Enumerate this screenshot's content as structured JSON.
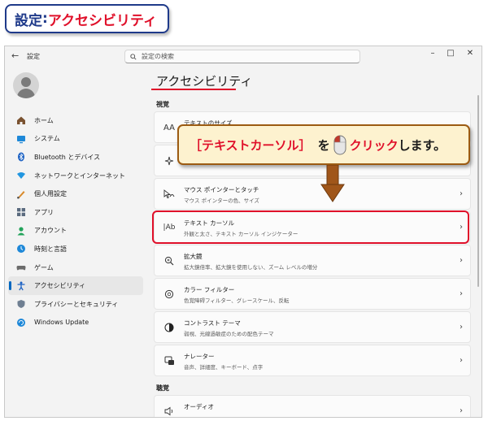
{
  "heading": {
    "key": "設定",
    "sep": ":",
    "value": "アクセシビリティ"
  },
  "window": {
    "back_icon": "back-arrow-icon",
    "title": "設定",
    "search_placeholder": "設定の検索",
    "controls": [
      "minimize-icon",
      "maximize-icon",
      "close-icon"
    ]
  },
  "nav": {
    "items": [
      {
        "label": "ホーム",
        "icon": "home-icon"
      },
      {
        "label": "システム",
        "icon": "system-icon"
      },
      {
        "label": "Bluetooth とデバイス",
        "icon": "bluetooth-icon"
      },
      {
        "label": "ネットワークとインターネット",
        "icon": "network-icon"
      },
      {
        "label": "個人用設定",
        "icon": "personalization-icon"
      },
      {
        "label": "アプリ",
        "icon": "apps-icon"
      },
      {
        "label": "アカウント",
        "icon": "account-icon"
      },
      {
        "label": "時刻と言語",
        "icon": "time-language-icon"
      },
      {
        "label": "ゲーム",
        "icon": "gaming-icon"
      },
      {
        "label": "アクセシビリティ",
        "icon": "accessibility-icon",
        "active": true
      },
      {
        "label": "プライバシーとセキュリティ",
        "icon": "privacy-icon"
      },
      {
        "label": "Windows Update",
        "icon": "windows-update-icon"
      }
    ]
  },
  "main": {
    "title": "アクセシビリティ",
    "section_vision": "視覚",
    "section_hearing": "聴覚",
    "cards": [
      {
        "title": "テキストのサイズ",
        "desc": "",
        "icon": "text-size-icon"
      },
      {
        "title": "",
        "desc": "",
        "icon": "visual-effects-icon"
      },
      {
        "title": "マウス ポインターとタッチ",
        "desc": "マウス ポインターの色、サイズ",
        "icon": "mouse-pointer-icon"
      },
      {
        "title": "テキスト カーソル",
        "desc": "外観と太さ、テキスト カーソル インジケーター",
        "icon": "text-cursor-icon"
      },
      {
        "title": "拡大鏡",
        "desc": "拡大鏡倍率、拡大鏡を使用しない、ズーム レベルの増分",
        "icon": "magnifier-icon"
      },
      {
        "title": "カラー フィルター",
        "desc": "色覚障碍フィルター、グレースケール、反転",
        "icon": "color-filter-icon"
      },
      {
        "title": "コントラスト テーマ",
        "desc": "弱視、光線過敏症のための配色テーマ",
        "icon": "contrast-icon"
      },
      {
        "title": "ナレーター",
        "desc": "音声、詳細度、キーボード、点字",
        "icon": "narrator-icon"
      },
      {
        "title": "オーディオ",
        "desc": "",
        "icon": "audio-icon"
      }
    ]
  },
  "callout": {
    "target": "［テキストカーソル］",
    "particle": "を",
    "mouse_icon": "left-click-mouse-icon",
    "action": "クリック",
    "tail": "します。"
  },
  "colors": {
    "accent_red": "#e0102a",
    "heading_blue": "#1f3a8a",
    "callout_bg": "#fdf2cf",
    "arrow_brown": "#a0561a"
  }
}
